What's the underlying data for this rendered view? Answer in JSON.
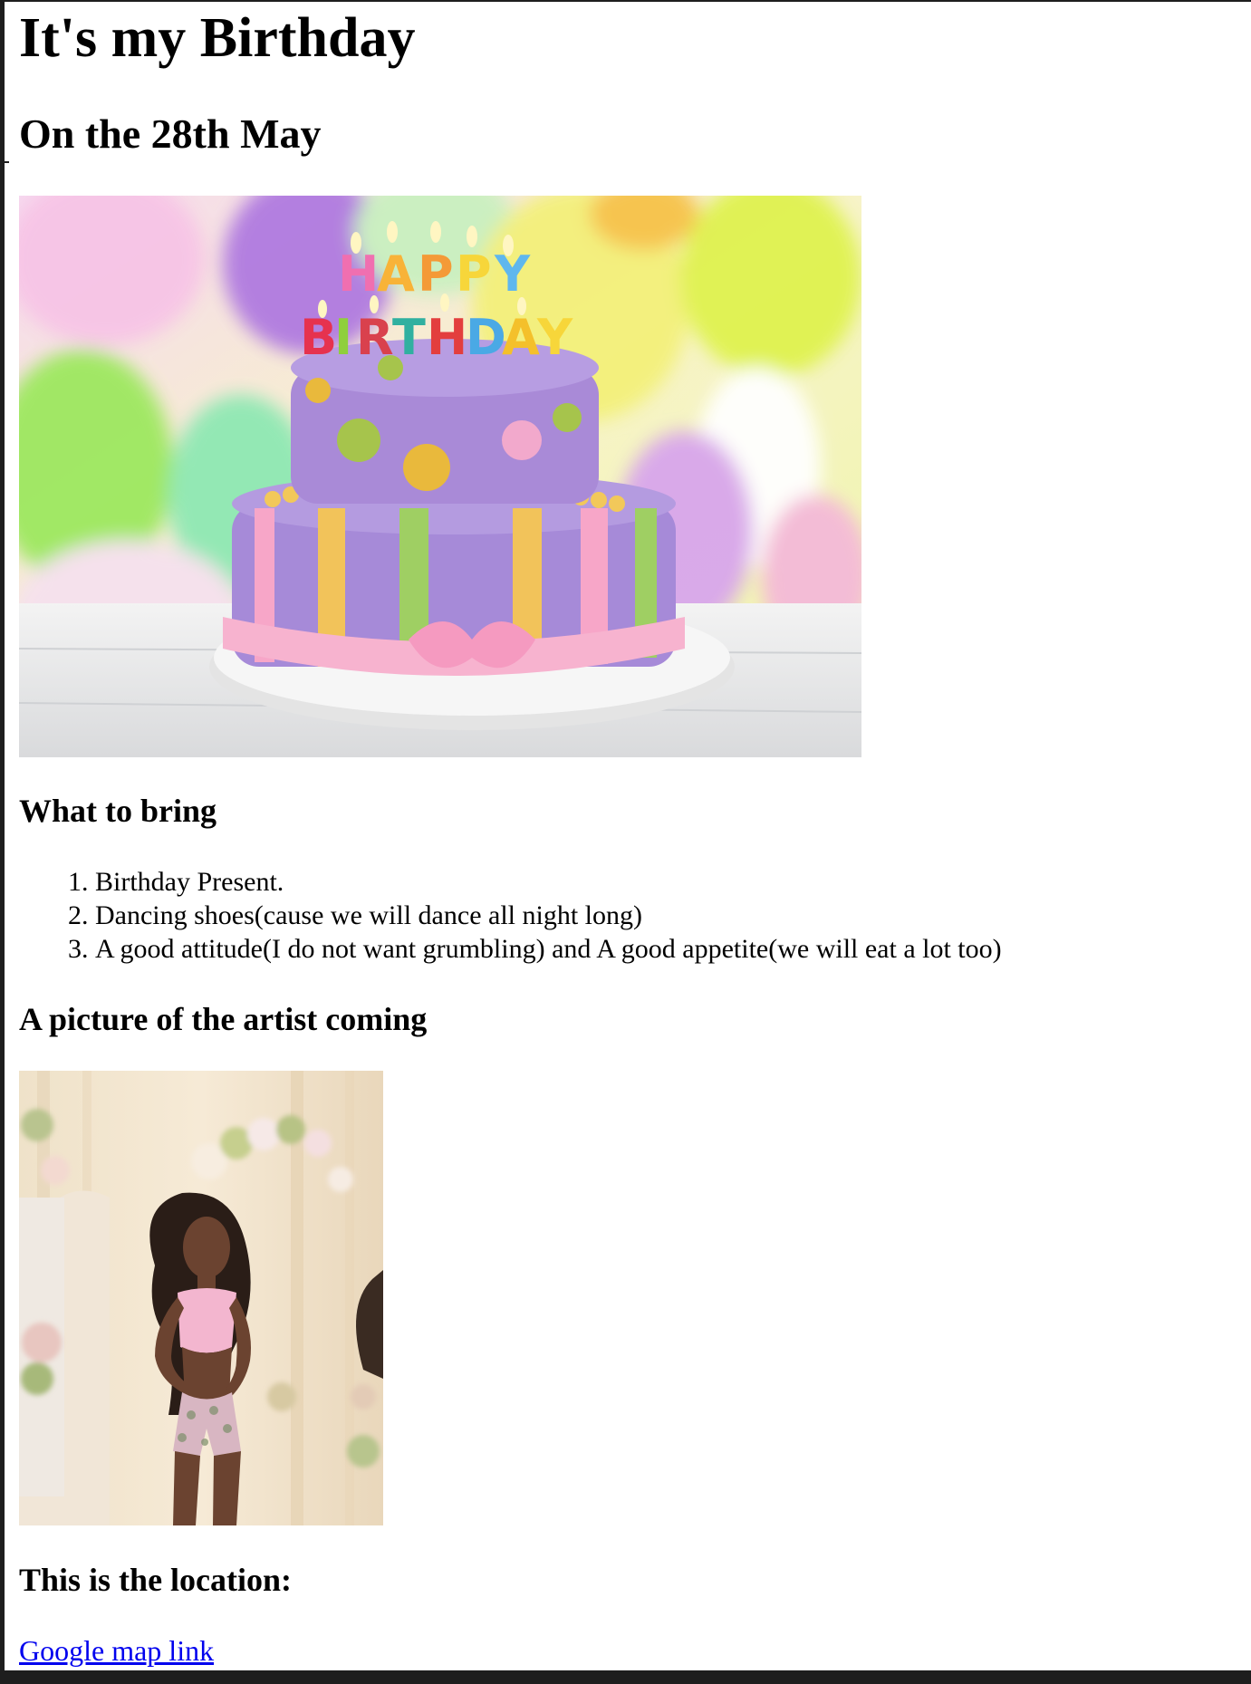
{
  "page": {
    "title": "It's my Birthday",
    "subtitle": "On the 28th May"
  },
  "sections": {
    "bring_heading": "What to bring",
    "bring_items": [
      "Birthday Present.",
      "Dancing shoes(cause we will dance all night long)",
      "A good attitude(I do not want grumbling) and A good appetite(we will eat a lot too)"
    ],
    "artist_heading": "A picture of the artist coming",
    "location_heading": "This is the location:",
    "map_link": "Google map link"
  },
  "images": {
    "cake_candles_text": "HAPPY BIRTHDAY"
  },
  "colors": {
    "link": "#0000ee",
    "page_background": "#ffffff",
    "frame": "#1e1e1e"
  }
}
